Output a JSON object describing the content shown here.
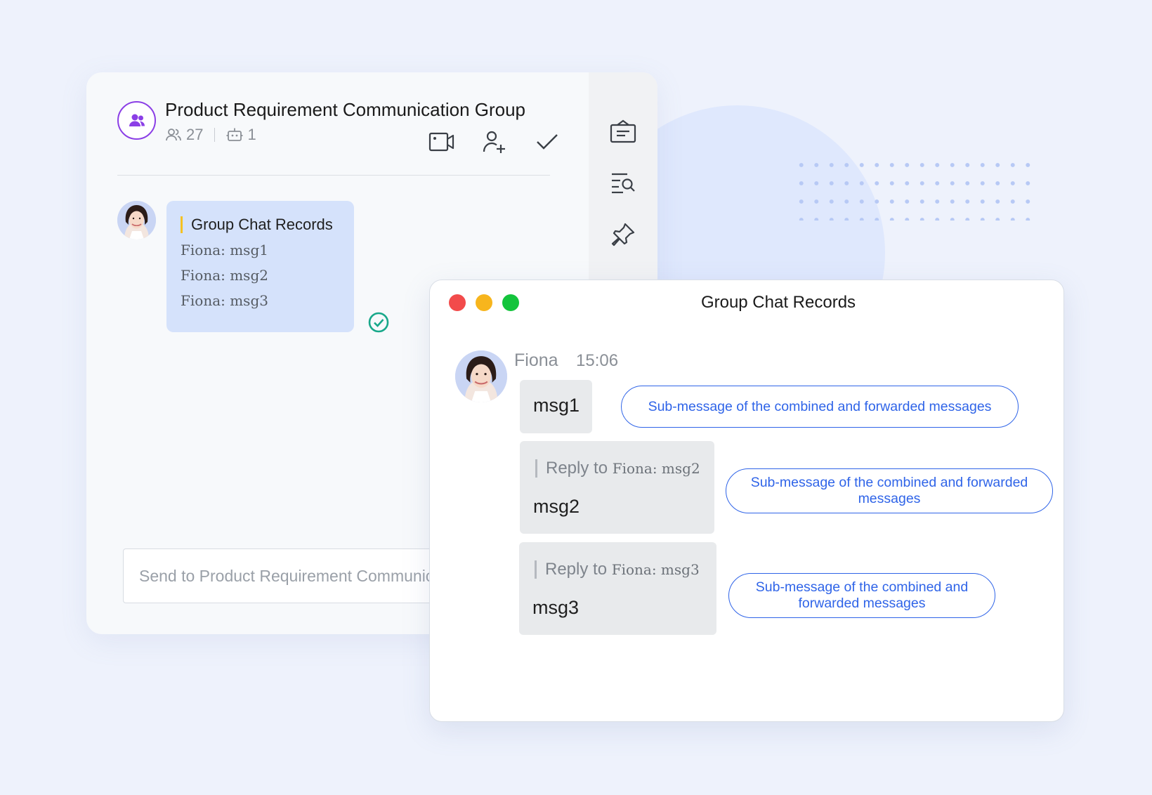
{
  "main": {
    "title": "Product Requirement Communication Group",
    "member_count": "27",
    "bot_count": "1",
    "card": {
      "title": "Group Chat Records",
      "lines": [
        "Fiona: msg1",
        "Fiona: msg2",
        "Fiona: msg3"
      ]
    },
    "composer_placeholder": "Send to Product Requirement Communication Group"
  },
  "records": {
    "title": "Group Chat Records",
    "sender": "Fiona",
    "time": "15:06",
    "messages": [
      {
        "text": "msg1",
        "annotation": "Sub-message of the combined and forwarded messages"
      },
      {
        "reply_prefix": "Reply to",
        "reply_body": "Fiona: msg2",
        "text": "msg2",
        "annotation": "Sub-message of the combined and forwarded messages"
      },
      {
        "reply_prefix": "Reply to",
        "reply_body": "Fiona: msg3",
        "text": "msg3",
        "annotation": "Sub-message of the combined and forwarded messages"
      }
    ]
  },
  "icons": {
    "group": "group-icon",
    "members": "members-icon",
    "bot": "bot-icon",
    "video_call": "video-call-icon",
    "add_member": "add-member-icon",
    "checkmark": "checkmark-icon",
    "notice": "notice-icon",
    "search_history": "search-history-icon",
    "pin": "pin-icon",
    "sent_status": "sent-status-icon"
  },
  "colors": {
    "accent_purple": "#8b3fe6",
    "link_blue": "#2f64e8",
    "card_blue": "#d5e2fb",
    "check_green": "#18a88a",
    "traffic_red": "#f24b4b",
    "traffic_yellow": "#f7b51d",
    "traffic_green": "#14c43c"
  }
}
